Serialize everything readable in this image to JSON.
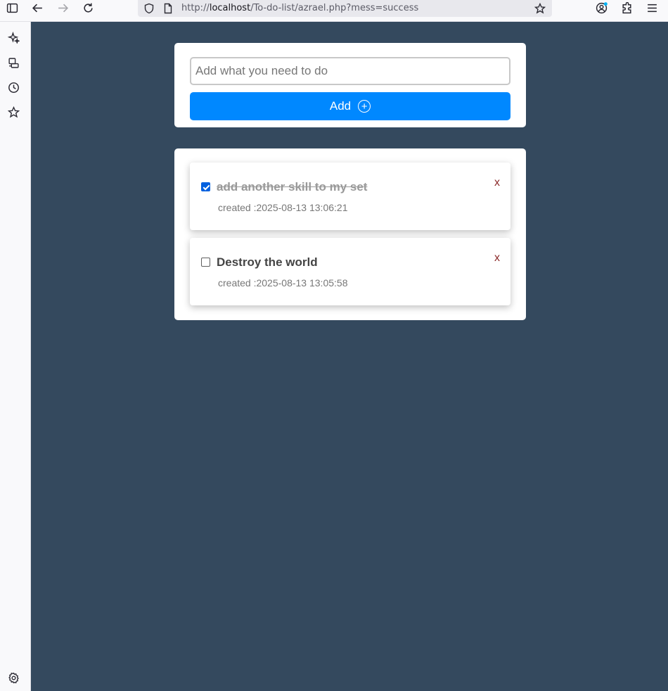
{
  "browser": {
    "url_prefix": "http://",
    "url_host": "localhost",
    "url_path": "/To-do-list/azrael.php?mess=success"
  },
  "form": {
    "input_placeholder": "Add what you need to do",
    "input_value": "",
    "add_label": "Add",
    "add_icon": "plus-circle-icon"
  },
  "todos": [
    {
      "title": "add another skill to my set",
      "checked": true,
      "created_label": "created :2025-08-13 13:06:21",
      "remove_label": "x"
    },
    {
      "title": "Destroy the world",
      "checked": false,
      "created_label": "created :2025-08-13 13:05:58",
      "remove_label": "x"
    }
  ],
  "colors": {
    "page_background": "#34495e",
    "add_button": "#0088ff",
    "remove_x": "#8b2a2a"
  }
}
